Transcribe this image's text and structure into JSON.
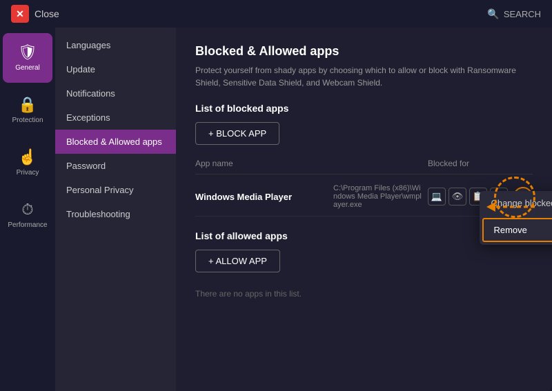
{
  "titleBar": {
    "closeLabel": "✕",
    "closeText": "Close",
    "searchLabel": "SEARCH"
  },
  "iconNav": {
    "items": [
      {
        "id": "general",
        "icon": "🛡",
        "label": "General",
        "active": true
      },
      {
        "id": "protection",
        "icon": "🔒",
        "label": "Protection",
        "active": false
      },
      {
        "id": "privacy",
        "icon": "👆",
        "label": "Privacy",
        "active": false
      },
      {
        "id": "performance",
        "icon": "⏱",
        "label": "Performance",
        "active": false
      }
    ]
  },
  "settingsNav": {
    "items": [
      {
        "id": "languages",
        "label": "Languages",
        "active": false
      },
      {
        "id": "update",
        "label": "Update",
        "active": false
      },
      {
        "id": "notifications",
        "label": "Notifications",
        "active": false
      },
      {
        "id": "exceptions",
        "label": "Exceptions",
        "active": false
      },
      {
        "id": "blocked-allowed",
        "label": "Blocked & Allowed apps",
        "active": true
      },
      {
        "id": "password",
        "label": "Password",
        "active": false
      },
      {
        "id": "personal-privacy",
        "label": "Personal Privacy",
        "active": false
      },
      {
        "id": "troubleshooting",
        "label": "Troubleshooting",
        "active": false
      }
    ]
  },
  "mainPanel": {
    "title": "Blocked & Allowed apps",
    "description": "Protect yourself from shady apps by choosing which to allow or block with Ransomware Shield, Sensitive Data Shield, and Webcam Shield.",
    "blockedSection": {
      "title": "List of blocked apps",
      "addButton": "+ BLOCK APP",
      "tableHeaders": {
        "appName": "App name",
        "blockedFor": "Blocked for"
      },
      "apps": [
        {
          "name": "Windows Media Player",
          "path": "C:\\Program Files (x86)\\Windows Media Player\\wmplayer.exe",
          "icons": [
            "💻",
            "👁",
            "📋",
            "🎥"
          ]
        }
      ]
    },
    "allowedSection": {
      "title": "List of allowed apps",
      "addButton": "+ ALLOW APP",
      "emptyText": "There are no apps in this list."
    },
    "dropdown": {
      "changeLabel": "Change blocked features",
      "removeLabel": "Remove"
    }
  },
  "colors": {
    "accent": "#7b2d8b",
    "orange": "#e67e00",
    "background": "#1e1e30",
    "sidebar": "#252535",
    "text": "#ffffff",
    "muted": "#888888"
  }
}
